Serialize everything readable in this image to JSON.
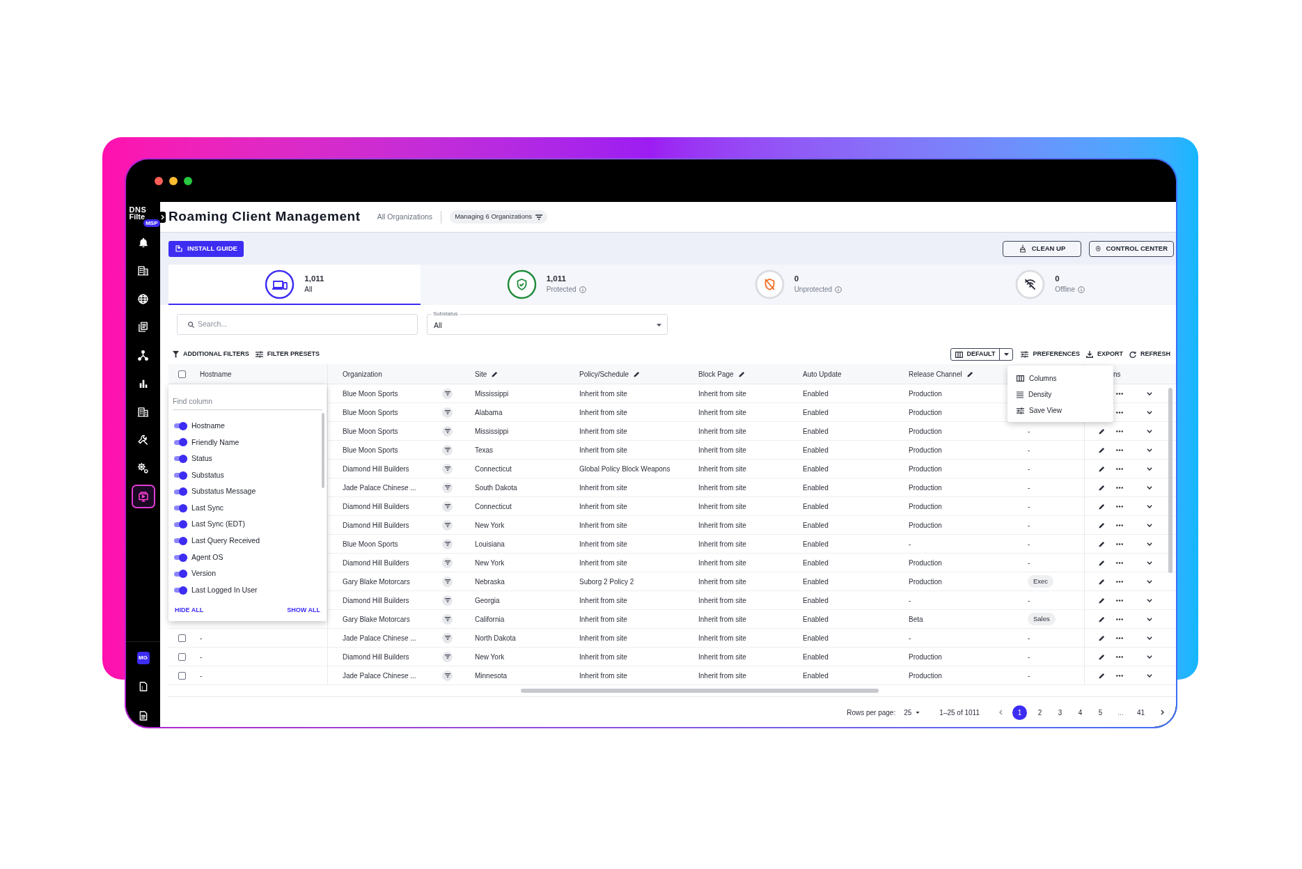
{
  "sidebar": {
    "logo": {
      "line_1": "DNS",
      "line_2": "Filte",
      "badge": "MSP"
    },
    "items": [
      {
        "selected": false
      },
      {
        "selected": false
      },
      {
        "selected": false
      },
      {
        "selected": false
      },
      {
        "selected": false
      },
      {
        "selected": false
      },
      {
        "selected": false
      },
      {
        "selected": false
      },
      {
        "selected": false
      },
      {
        "selected": true
      }
    ],
    "user_initials": "MG"
  },
  "header": {
    "title": "Roaming Client Management",
    "scope": "All Organizations",
    "managing_chip": "Managing 6 Organizations"
  },
  "actions": {
    "install_guide": "INSTALL GUIDE",
    "buttons": [
      "CLEAN UP",
      "CONTROL CENTER"
    ]
  },
  "status_tabs": [
    {
      "kind": "all",
      "count": "1,011",
      "label": "All",
      "info": false,
      "selected": true
    },
    {
      "kind": "protected",
      "count": "1,011",
      "label": "Protected",
      "info": true,
      "selected": false
    },
    {
      "kind": "unprotected",
      "count": "0",
      "label": "Unprotected",
      "info": true,
      "selected": false
    },
    {
      "kind": "offline",
      "count": "0",
      "label": "Offline",
      "info": true,
      "selected": false
    }
  ],
  "filters": {
    "search": {
      "placeholder": "Search..."
    },
    "substatus": {
      "label": "Substatus",
      "value": "All"
    }
  },
  "toolbar": {
    "left": [
      "ADDITIONAL FILTERS",
      "FILTER PRESETS"
    ],
    "view": "DEFAULT",
    "right": [
      "PREFERENCES",
      "EXPORT",
      "REFRESH"
    ]
  },
  "preferences_menu": {
    "items": [
      "Columns",
      "Density",
      "Save View"
    ]
  },
  "table": {
    "select_all": {
      "checked": false
    },
    "columns": [
      {
        "label": "Hostname",
        "editable": false
      },
      {
        "label": "Organization",
        "editable": false
      },
      {
        "label": "Site",
        "editable": true
      },
      {
        "label": "Policy/Schedule",
        "editable": true
      },
      {
        "label": "Block Page",
        "editable": true
      },
      {
        "label": "Auto Update",
        "editable": false
      },
      {
        "label": "Release Channel",
        "editable": true
      }
    ],
    "column_10_header": "ns",
    "rows": [
      {
        "organization": "Blue Moon Sports",
        "site": "Mississippi",
        "policy": "Inherit from site",
        "block_page": "Inherit from site",
        "auto_update": "Enabled",
        "release_channel": "Production"
      },
      {
        "organization": "Blue Moon Sports",
        "site": "Alabama",
        "policy": "Inherit from site",
        "block_page": "Inherit from site",
        "auto_update": "Enabled",
        "release_channel": "Production"
      },
      {
        "organization": "Blue Moon Sports",
        "site": "Mississippi",
        "policy": "Inherit from site",
        "block_page": "Inherit from site",
        "auto_update": "Enabled",
        "release_channel": "Production",
        "tag": {
          "kind": "text",
          "text": "-"
        }
      },
      {
        "organization": "Blue Moon Sports",
        "site": "Texas",
        "policy": "Inherit from site",
        "block_page": "Inherit from site",
        "auto_update": "Enabled",
        "release_channel": "Production",
        "tag": {
          "kind": "text",
          "text": "-"
        }
      },
      {
        "organization": "Diamond Hill Builders",
        "site": "Connecticut",
        "policy": "Global Policy Block Weapons",
        "block_page": "Inherit from site",
        "auto_update": "Enabled",
        "release_channel": "Production",
        "tag": {
          "kind": "text",
          "text": "-"
        }
      },
      {
        "organization": "Jade Palace Chinese ...",
        "site": "South Dakota",
        "policy": "Inherit from site",
        "block_page": "Inherit from site",
        "auto_update": "Enabled",
        "release_channel": "Production",
        "tag": {
          "kind": "text",
          "text": "-"
        }
      },
      {
        "organization": "Diamond Hill Builders",
        "site": "Connecticut",
        "policy": "Inherit from site",
        "block_page": "Inherit from site",
        "auto_update": "Enabled",
        "release_channel": "Production",
        "tag": {
          "kind": "text",
          "text": "-"
        }
      },
      {
        "organization": "Diamond Hill Builders",
        "site": "New York",
        "policy": "Inherit from site",
        "block_page": "Inherit from site",
        "auto_update": "Enabled",
        "release_channel": "Production",
        "tag": {
          "kind": "text",
          "text": "-"
        }
      },
      {
        "organization": "Blue Moon Sports",
        "site": "Louisiana",
        "policy": "Inherit from site",
        "block_page": "Inherit from site",
        "auto_update": "Enabled",
        "release_channel": "-",
        "tag": {
          "kind": "text",
          "text": "-"
        }
      },
      {
        "organization": "Diamond Hill Builders",
        "site": "New York",
        "policy": "Inherit from site",
        "block_page": "Inherit from site",
        "auto_update": "Enabled",
        "release_channel": "Production",
        "tag": {
          "kind": "text",
          "text": "-"
        }
      },
      {
        "organization": "Gary Blake Motorcars",
        "site": "Nebraska",
        "policy": "Suborg 2 Policy 2",
        "block_page": "Inherit from site",
        "auto_update": "Enabled",
        "release_channel": "Production",
        "tag": {
          "kind": "chip",
          "text": "Exec"
        }
      },
      {
        "organization": "Diamond Hill Builders",
        "site": "Georgia",
        "policy": "Inherit from site",
        "block_page": "Inherit from site",
        "auto_update": "Enabled",
        "release_channel": "-",
        "tag": {
          "kind": "text",
          "text": "-"
        }
      },
      {
        "organization": "Gary Blake Motorcars",
        "site": "California",
        "policy": "Inherit from site",
        "block_page": "Inherit from site",
        "auto_update": "Enabled",
        "release_channel": "Beta",
        "tag": {
          "kind": "chip",
          "text": "Sales"
        }
      },
      {
        "selected": false,
        "hostname": "-",
        "organization": "Jade Palace Chinese ...",
        "site": "North Dakota",
        "policy": "Inherit from site",
        "block_page": "Inherit from site",
        "auto_update": "Enabled",
        "release_channel": "-",
        "tag": {
          "kind": "text",
          "text": "-"
        }
      },
      {
        "selected": false,
        "hostname": "-",
        "organization": "Diamond Hill Builders",
        "site": "New York",
        "policy": "Inherit from site",
        "block_page": "Inherit from site",
        "auto_update": "Enabled",
        "release_channel": "Production",
        "tag": {
          "kind": "text",
          "text": "-"
        }
      },
      {
        "selected": false,
        "hostname": "-",
        "organization": "Jade Palace Chinese ...",
        "site": "Minnesota",
        "policy": "Inherit from site",
        "block_page": "Inherit from site",
        "auto_update": "Enabled",
        "release_channel": "Production",
        "tag": {
          "kind": "text",
          "text": "-"
        }
      }
    ]
  },
  "columns_panel": {
    "placeholder": "Find column",
    "columns": [
      {
        "label": "Hostname",
        "on": true
      },
      {
        "label": "Friendly Name",
        "on": true
      },
      {
        "label": "Status",
        "on": true
      },
      {
        "label": "Substatus",
        "on": true
      },
      {
        "label": "Substatus Message",
        "on": true
      },
      {
        "label": "Last Sync",
        "on": true
      },
      {
        "label": "Last Sync (EDT)",
        "on": true
      },
      {
        "label": "Last Query Received",
        "on": true
      },
      {
        "label": "Agent OS",
        "on": true
      },
      {
        "label": "Version",
        "on": true
      },
      {
        "label": "Last Logged In User",
        "on": true
      }
    ],
    "hide_all": "HIDE ALL",
    "show_all": "SHOW ALL"
  },
  "pagination": {
    "rows_per_page_label": "Rows per page:",
    "rows_per_page": "25",
    "range": "1–25 of 1011",
    "pages": [
      {
        "kind": "page",
        "label": "1",
        "selected": true
      },
      {
        "kind": "page",
        "label": "2",
        "selected": false
      },
      {
        "kind": "page",
        "label": "3",
        "selected": false
      },
      {
        "kind": "page",
        "label": "4",
        "selected": false
      },
      {
        "kind": "page",
        "label": "5",
        "selected": false
      },
      {
        "kind": "ellipsis",
        "label": "...",
        "selected": false
      },
      {
        "kind": "page",
        "label": "41",
        "selected": false
      }
    ]
  }
}
